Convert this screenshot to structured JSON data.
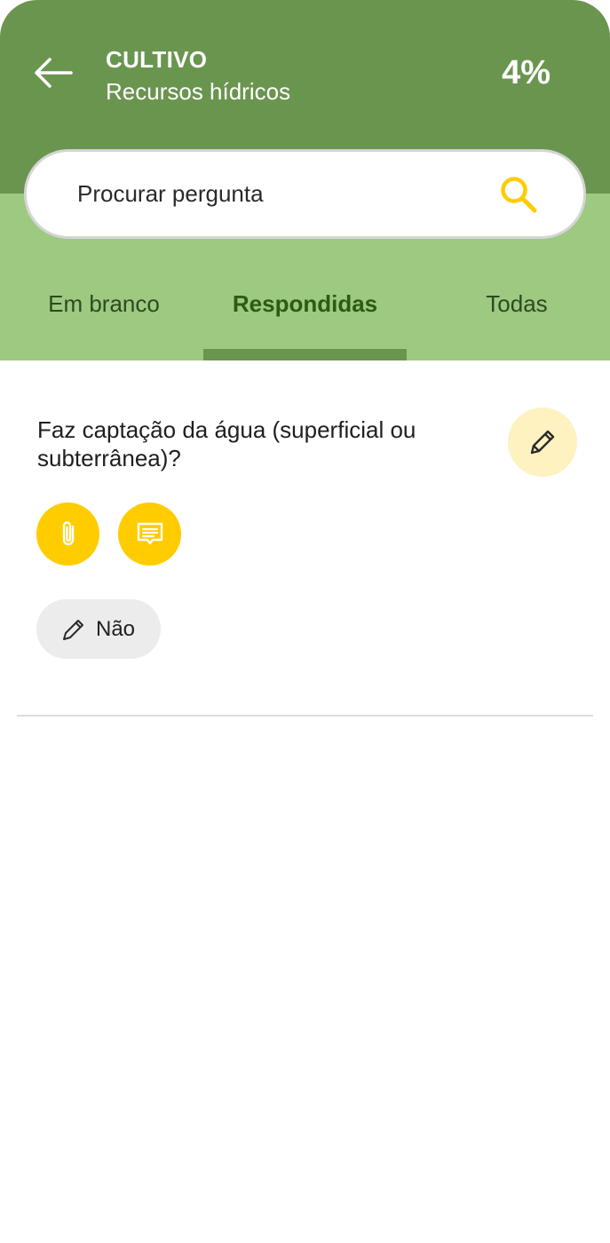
{
  "header": {
    "title": "CULTIVO",
    "subtitle": "Recursos hídricos",
    "progress": "4%",
    "back_icon": "arrow-left-icon"
  },
  "search": {
    "placeholder": "Procurar pergunta",
    "icon": "search-icon"
  },
  "tabs": [
    {
      "label": "Em branco",
      "active": false
    },
    {
      "label": "Respondidas",
      "active": true
    },
    {
      "label": "Todas",
      "active": false
    }
  ],
  "questions": [
    {
      "text": "Faz captação da água (superficial ou subterrânea)?",
      "edit_icon": "pencil-icon",
      "actions": [
        "paperclip-icon",
        "comment-icon"
      ],
      "answer": {
        "label": "Não",
        "icon": "pencil-icon"
      }
    }
  ],
  "colors": {
    "header_dark": "#6a954f",
    "header_light": "#9dc981",
    "accent_yellow": "#ffcc00",
    "edit_button_bg": "#fdf2c0",
    "tab_active_text": "#2d5a14",
    "chip_bg": "#ececec"
  }
}
